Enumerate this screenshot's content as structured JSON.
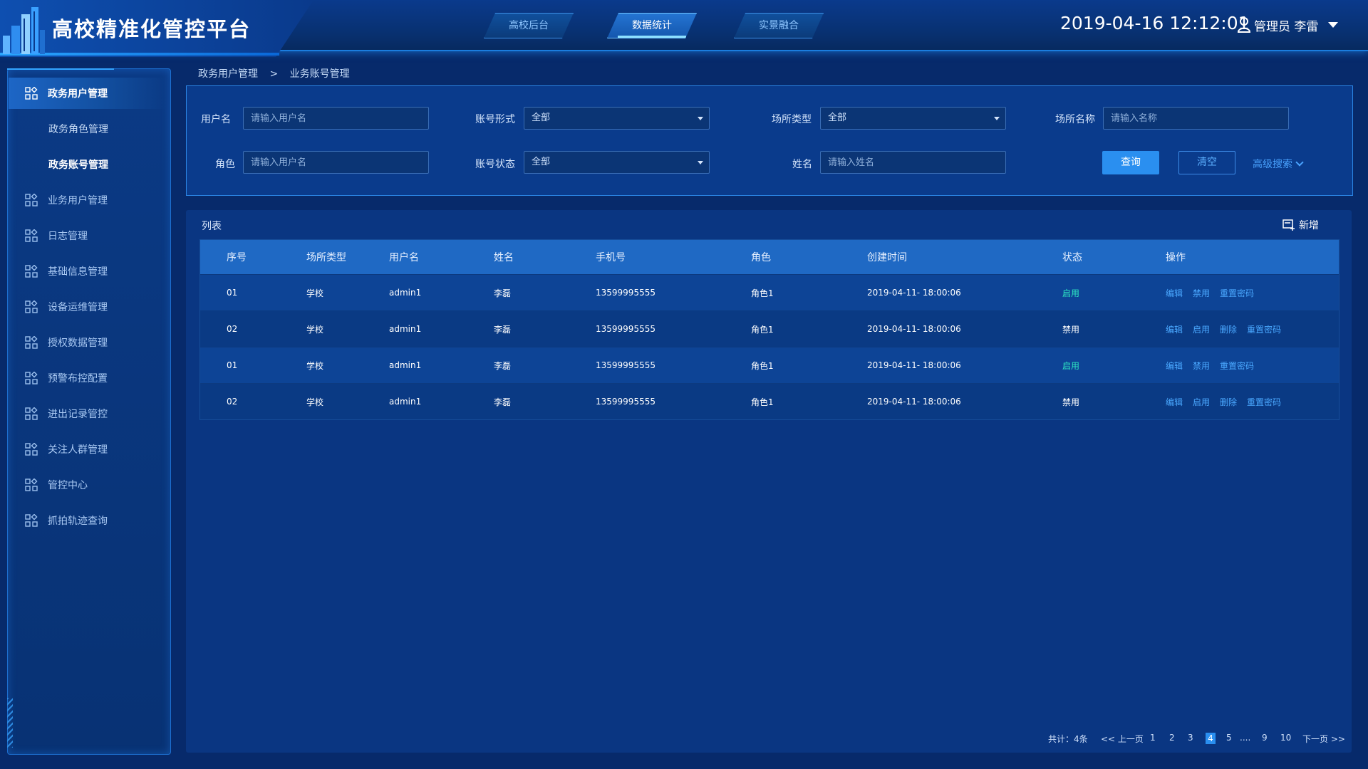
{
  "header": {
    "title": "高校精准化管控平台",
    "tabs": [
      {
        "label": "高校后台",
        "active": false
      },
      {
        "label": "数据统计",
        "active": true
      },
      {
        "label": "实景融合",
        "active": false
      }
    ],
    "datetime": "2019-04-16  12:12:01",
    "user": "管理员 李雷"
  },
  "sidebar": {
    "items": [
      {
        "label": "政务用户管理",
        "icon": "grid-icon",
        "active": true
      },
      {
        "label": "政务角色管理",
        "sub": true
      },
      {
        "label": "政务账号管理",
        "sub": true,
        "current": true
      },
      {
        "label": "业务用户管理",
        "icon": "grid-icon"
      },
      {
        "label": "日志管理",
        "icon": "grid-icon"
      },
      {
        "label": "基础信息管理",
        "icon": "grid-icon"
      },
      {
        "label": "设备运维管理",
        "icon": "grid-icon"
      },
      {
        "label": "授权数据管理",
        "icon": "grid-icon"
      },
      {
        "label": "预警布控配置",
        "icon": "grid-icon"
      },
      {
        "label": "进出记录管控",
        "icon": "grid-icon"
      },
      {
        "label": "关注人群管理",
        "icon": "grid-icon"
      },
      {
        "label": "管控中心",
        "icon": "grid-icon"
      },
      {
        "label": "抓拍轨迹查询",
        "icon": "grid-icon"
      }
    ]
  },
  "breadcrumb": {
    "parent": "政务用户管理",
    "separator": ">",
    "current": "业务账号管理"
  },
  "filters": {
    "username": {
      "label": "用户名",
      "placeholder": "请输入用户名"
    },
    "account_type": {
      "label": "账号形式",
      "value": "全部"
    },
    "venue_type": {
      "label": "场所类型",
      "value": "全部"
    },
    "venue_name": {
      "label": "场所名称",
      "placeholder": "请输入名称"
    },
    "role": {
      "label": "角色",
      "placeholder": "请输入用户名"
    },
    "account_status": {
      "label": "账号状态",
      "value": "全部"
    },
    "name": {
      "label": "姓名",
      "placeholder": "请输入姓名"
    },
    "query_label": "查询",
    "clear_label": "清空",
    "advanced_label": "高级搜索"
  },
  "list": {
    "title": "列表",
    "add_label": "新增",
    "columns": [
      "序号",
      "场所类型",
      "用户名",
      "姓名",
      "手机号",
      "角色",
      "创建时间",
      "状态",
      "操作"
    ],
    "rows": [
      {
        "no": "01",
        "venue_type": "学校",
        "username": "admin1",
        "name": "李磊",
        "phone": "13599995555",
        "role": "角色1",
        "created": "2019-04-11- 18:00:06",
        "status": "启用",
        "ops": [
          "编辑",
          "禁用",
          "重置密码"
        ]
      },
      {
        "no": "02",
        "venue_type": "学校",
        "username": "admin1",
        "name": "李磊",
        "phone": "13599995555",
        "role": "角色1",
        "created": "2019-04-11- 18:00:06",
        "status": "禁用",
        "ops": [
          "编辑",
          "启用",
          "删除",
          "重置密码"
        ]
      },
      {
        "no": "01",
        "venue_type": "学校",
        "username": "admin1",
        "name": "李磊",
        "phone": "13599995555",
        "role": "角色1",
        "created": "2019-04-11- 18:00:06",
        "status": "启用",
        "ops": [
          "编辑",
          "禁用",
          "重置密码"
        ]
      },
      {
        "no": "02",
        "venue_type": "学校",
        "username": "admin1",
        "name": "李磊",
        "phone": "13599995555",
        "role": "角色1",
        "created": "2019-04-11- 18:00:06",
        "status": "禁用",
        "ops": [
          "编辑",
          "启用",
          "删除",
          "重置密码"
        ]
      }
    ]
  },
  "pagination": {
    "total": "共计：4条",
    "prev": "<< 上一页",
    "pages": [
      "1",
      "2",
      "3",
      "4",
      "5",
      "....",
      "9",
      "10"
    ],
    "current": "4",
    "next": "下一页 >>"
  },
  "colors": {
    "accent": "#2a8ff0",
    "status_enabled": "#2ee6c2",
    "link": "#4aa8ff"
  }
}
